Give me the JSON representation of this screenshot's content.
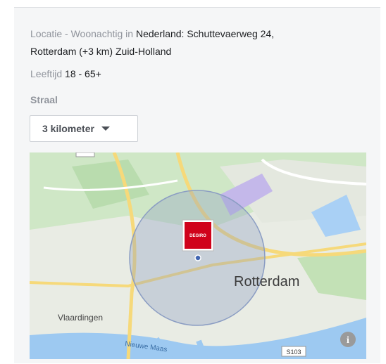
{
  "targeting": {
    "location_label": "Locatie - Woonachtig in",
    "location_value_line1": "Nederland: Schuttevaerweg 24,",
    "location_value_line2": "Rotterdam (+3 km) Zuid-Holland",
    "age_label": "Leeftijd",
    "age_value": "18 - 65+",
    "radius_label": "Straal",
    "radius_value": "3 kilometer"
  },
  "map": {
    "city_label": "Rotterdam",
    "town_label": "Vlaardingen",
    "river_label": "Nieuwe Maas",
    "road_shield": "S103",
    "marker_brand": "DEGIRO",
    "marker_color": "#d0021b",
    "circle_color": "#8b9dc3",
    "info_icon": "info-icon"
  }
}
